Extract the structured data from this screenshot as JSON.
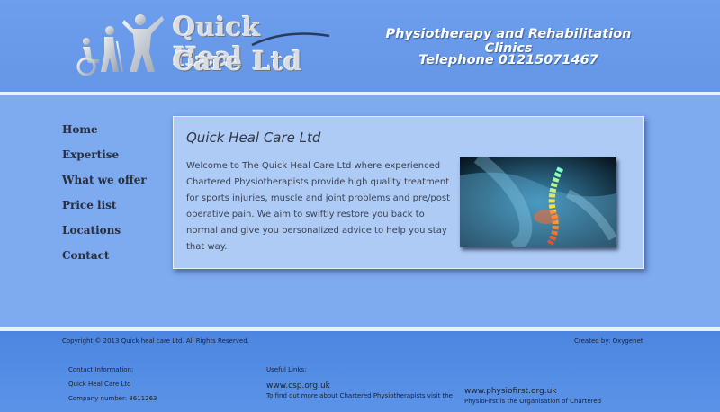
{
  "header": {
    "logo_line1": "Quick Heal",
    "logo_line2": "Care Ltd",
    "tagline": "Physiotherapy and Rehabilitation Clinics",
    "telephone": "Telephone 01215071467"
  },
  "nav": {
    "items": [
      {
        "label": "Home"
      },
      {
        "label": "Expertise"
      },
      {
        "label": "What we offer"
      },
      {
        "label": "Price list"
      },
      {
        "label": "Locations"
      },
      {
        "label": "Contact"
      }
    ]
  },
  "main": {
    "title": "Quick Heal Care Ltd",
    "intro": "Welcome to The Quick Heal Care Ltd where experienced Chartered Physiotherapists provide high quality treatment for sports injuries, muscle and joint problems and pre/post operative pain. We aim to swiftly restore you back to normal and give you personalized advice to help you stay that way."
  },
  "footer": {
    "copyright": "Copyright © 2013 Quick heal care Ltd. All Rights Reserved.",
    "created_by": "Created by: Oxygenet",
    "contact_heading": "Contact Information:",
    "company_name": "Quick Heal Care Ltd",
    "company_number": "Company number: 8611263",
    "useful_links_heading": "Useful Links:",
    "link1": "www.csp.org.uk",
    "link1_desc": "To find out more about Chartered Physiotherapists visit the",
    "link2": "www.physiofirst.org.uk",
    "link2_desc": "PhysioFirst is the Organisation of Chartered"
  },
  "colors": {
    "header_bg": "#6d9ded",
    "body_bg": "#7eaaf0",
    "card_bg": "#aecbf5",
    "footer_bg": "#4c86e0"
  }
}
